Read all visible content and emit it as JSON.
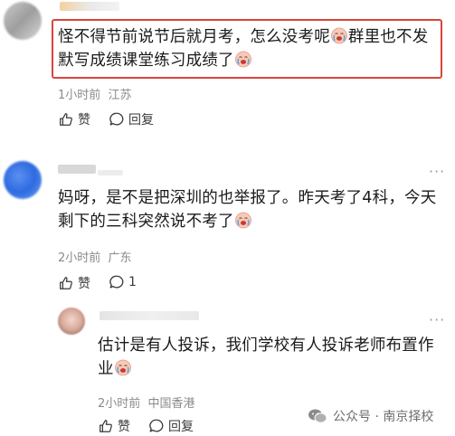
{
  "comments": [
    {
      "line1": "怪不得节前说节后就月考，怎么没考呢",
      "line1b": "群里也不发",
      "line2": "默写成绩课堂练习成绩了",
      "time": "1小时前",
      "location": "江苏",
      "like_label": "赞",
      "reply_label": "回复"
    },
    {
      "line1": "妈呀，是不是把深圳的也举报了。昨天考了4科，今天",
      "line2": "剩下的三科突然说不考了",
      "time": "2小时前",
      "location": "广东",
      "like_label": "赞",
      "reply_count": "1"
    },
    {
      "line1": "估计是有人投诉，我们学校有人投诉老师布置作",
      "line2": "业",
      "time": "2小时前",
      "location": "中国香港",
      "like_label": "赞",
      "reply_label": "回复"
    }
  ],
  "more_glyph": "···",
  "watermark": "公众号 · 南京择校",
  "colors": {
    "highlight": "#d9453a",
    "meta": "#8a8a8a"
  },
  "icons": [
    "thumbs-up-icon",
    "comment-icon",
    "crying-emoji-icon",
    "wechat-icon"
  ]
}
